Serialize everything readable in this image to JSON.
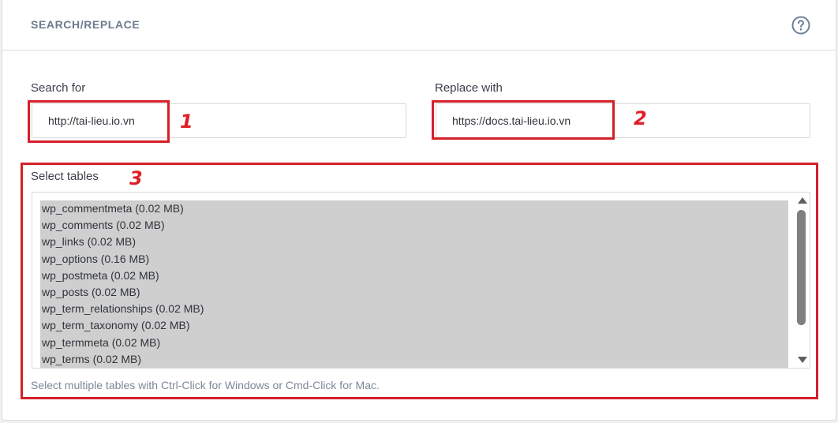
{
  "header": {
    "title": "SEARCH/REPLACE",
    "help_icon": "question-circle-icon"
  },
  "search": {
    "label": "Search for",
    "value": "http://tai-lieu.io.vn"
  },
  "replace": {
    "label": "Replace with",
    "value": "https://docs.tai-lieu.io.vn"
  },
  "tables": {
    "label": "Select tables",
    "options": [
      "wp_commentmeta (0.02 MB)",
      "wp_comments (0.02 MB)",
      "wp_links (0.02 MB)",
      "wp_options (0.16 MB)",
      "wp_postmeta (0.02 MB)",
      "wp_posts (0.02 MB)",
      "wp_term_relationships (0.02 MB)",
      "wp_term_taxonomy (0.02 MB)",
      "wp_termmeta (0.02 MB)",
      "wp_terms (0.02 MB)"
    ],
    "hint": "Select multiple tables with Ctrl-Click for Windows or Cmd-Click for Mac."
  },
  "annotations": {
    "one": "1",
    "two": "2",
    "three": "3",
    "color": "#d4202a"
  },
  "colors": {
    "selected_bg": "#cfcfcf",
    "header_text": "#6d7b8f"
  }
}
